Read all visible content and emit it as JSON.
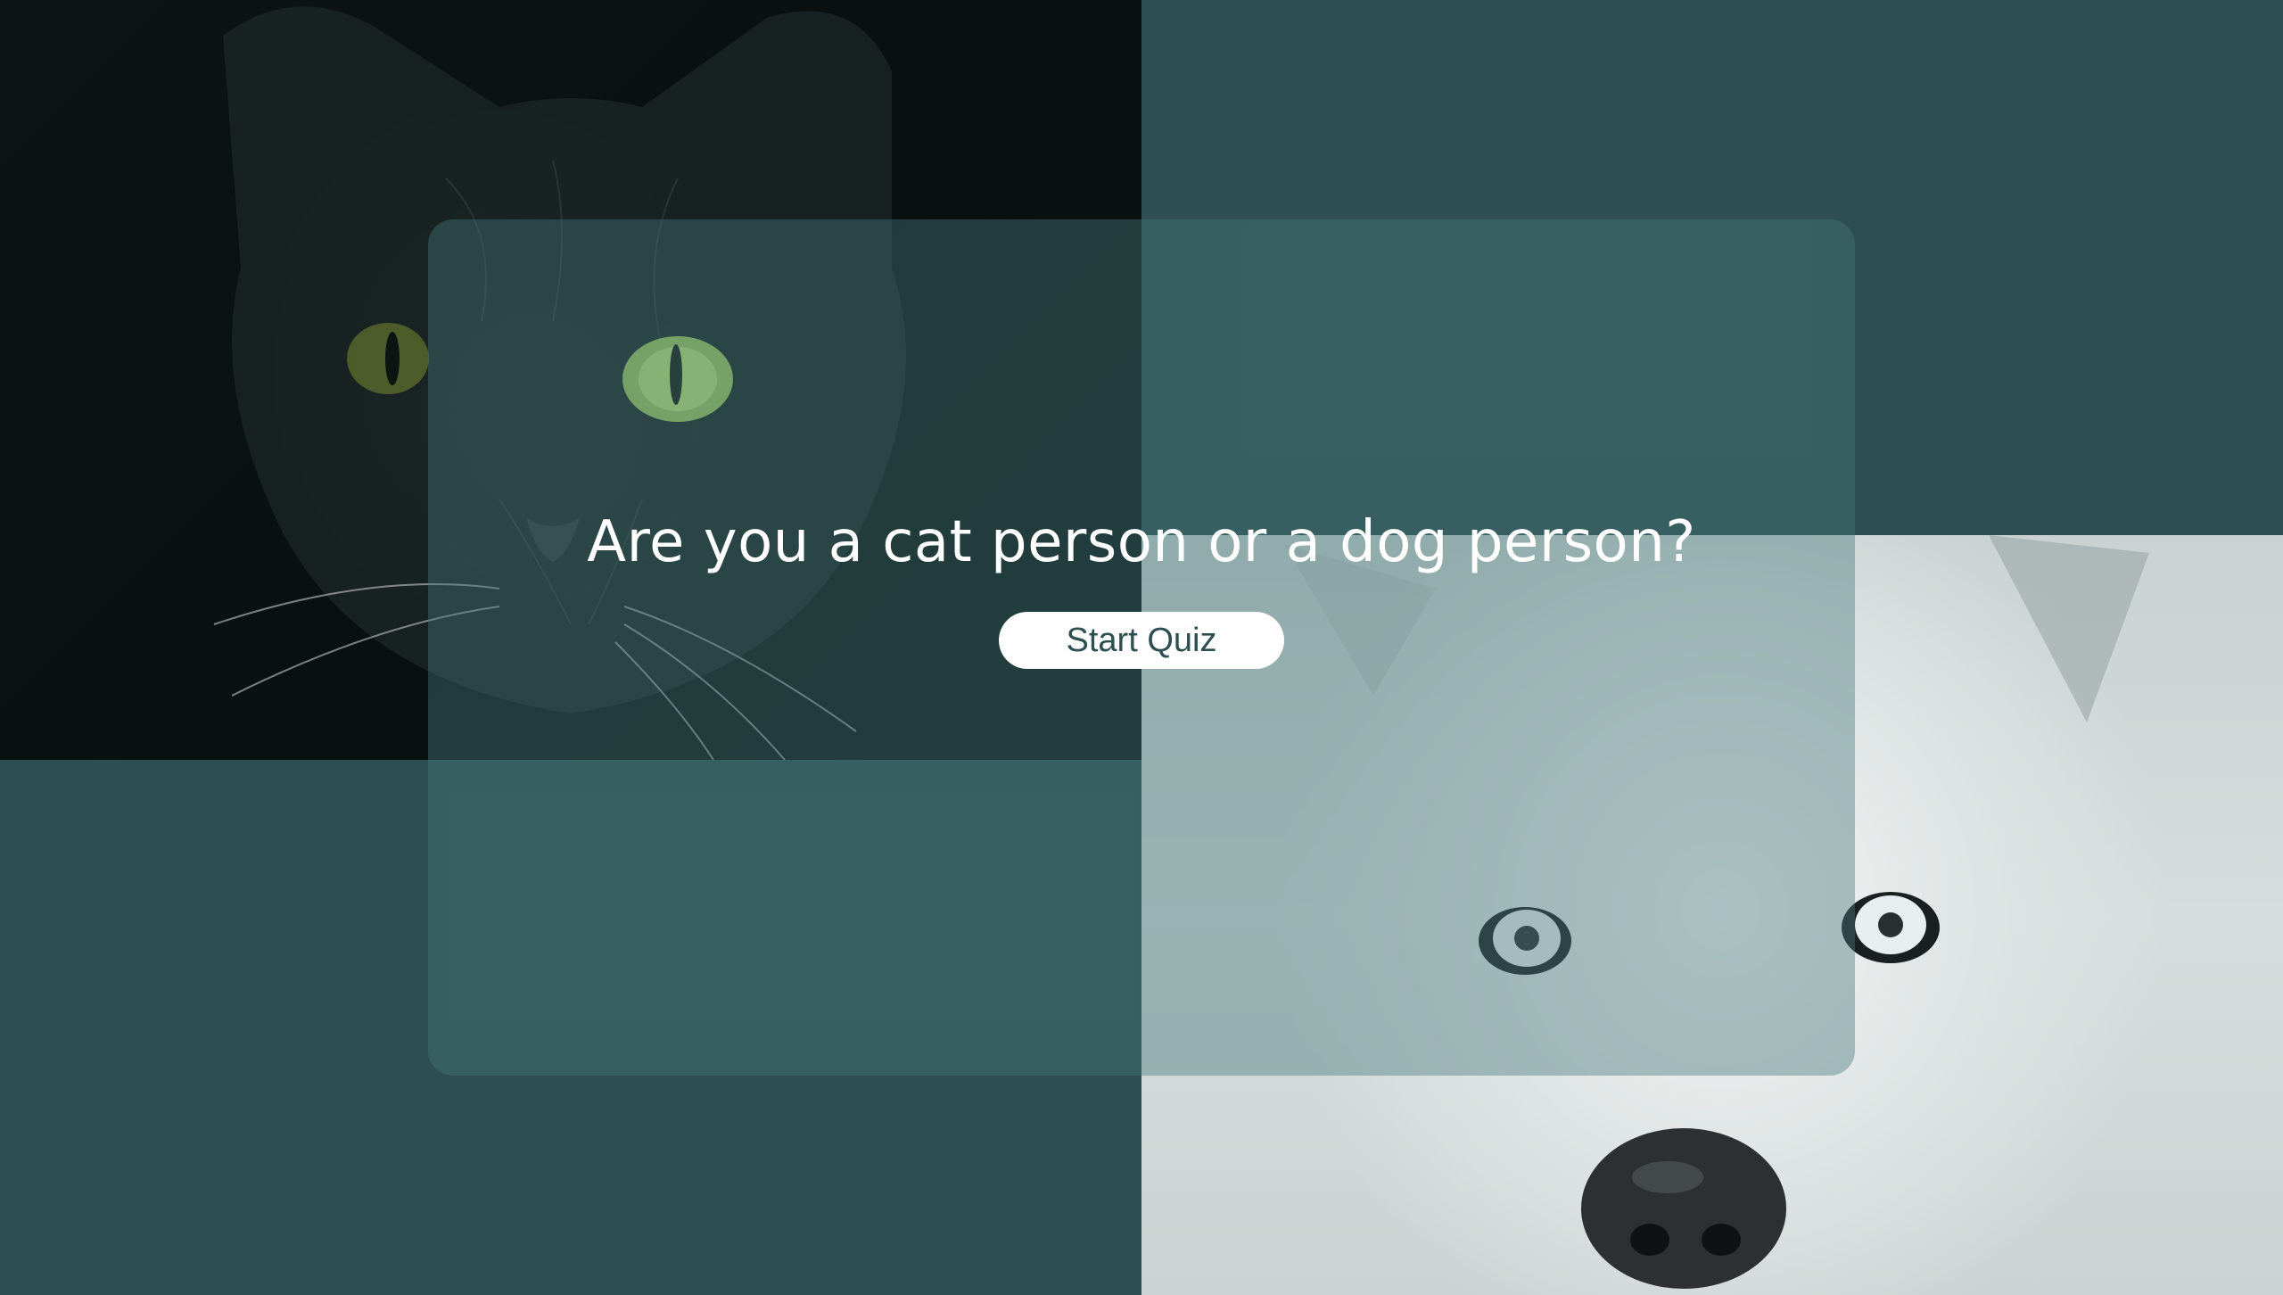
{
  "page": {
    "background_color": "#2d4f51",
    "card_color": "rgba(70,120,122,0.42)"
  },
  "images": {
    "cat": "black cat close-up photo",
    "dog": "white husky close-up photo"
  },
  "hero": {
    "title": "Are you a cat person or a dog person?",
    "button_label": "Start Quiz",
    "button_text_color": "#2d4f51",
    "button_background": "#ffffff"
  }
}
